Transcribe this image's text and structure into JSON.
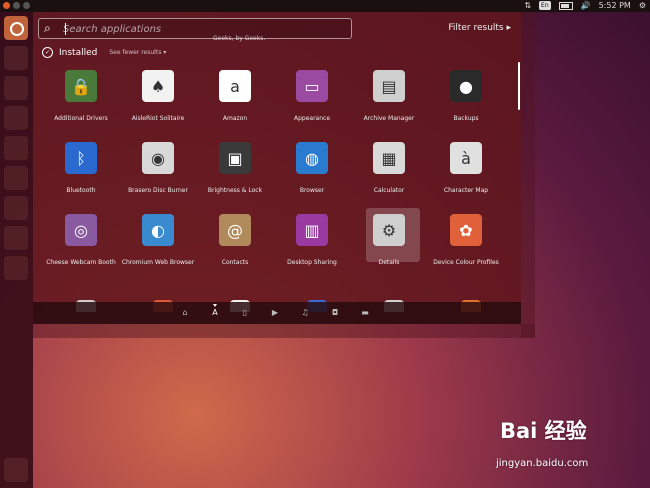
{
  "topbar": {
    "keyboard_layout": "En",
    "time": "5:52 PM"
  },
  "launcher": {
    "items": [
      "dash-home",
      "item-1",
      "item-2",
      "item-3",
      "item-4",
      "item-5",
      "item-6",
      "item-7",
      "item-8",
      "item-9",
      "trash"
    ]
  },
  "dash": {
    "search_placeholder": "Search applications",
    "filter_label": "Filter results ▸",
    "overlay_text": "Geeks, by Geeks.",
    "category_title": "Installed",
    "category_more": "See fewer results ▾",
    "apps": [
      {
        "label": "Additional Drivers",
        "icon": "chip-lock-icon",
        "color": "#4a7a3a"
      },
      {
        "label": "AisleRiot Solitaire",
        "icon": "cards-icon",
        "color": "#f2f2f2"
      },
      {
        "label": "Amazon",
        "icon": "amazon-icon",
        "color": "#ffffff"
      },
      {
        "label": "Appearance",
        "icon": "monitor-icon",
        "color": "#9a4aa0"
      },
      {
        "label": "Archive Manager",
        "icon": "archive-icon",
        "color": "#cfcfcf"
      },
      {
        "label": "Backups",
        "icon": "safe-icon",
        "color": "#2a2a2a"
      },
      {
        "label": "Bluetooth",
        "icon": "bluetooth-icon",
        "color": "#2a6ad0"
      },
      {
        "label": "Brasero Disc Burner",
        "icon": "disc-icon",
        "color": "#d8d8d8"
      },
      {
        "label": "Brightness & Lock",
        "icon": "monitor-lock-icon",
        "color": "#3a3a3a"
      },
      {
        "label": "Browser",
        "icon": "globe-icon",
        "color": "#2a7ad0"
      },
      {
        "label": "Calculator",
        "icon": "calculator-icon",
        "color": "#d9d9d9"
      },
      {
        "label": "Character Map",
        "icon": "charmap-icon",
        "color": "#e0e0e0"
      },
      {
        "label": "Cheese Webcam Booth",
        "icon": "webcam-icon",
        "color": "#8a5aa0"
      },
      {
        "label": "Chromium Web Browser",
        "icon": "chromium-icon",
        "color": "#3a8ad0"
      },
      {
        "label": "Contacts",
        "icon": "contacts-icon",
        "color": "#b08a5a"
      },
      {
        "label": "Desktop Sharing",
        "icon": "desktop-share-icon",
        "color": "#9a3aa0"
      },
      {
        "label": "Details",
        "icon": "gear-icon",
        "color": "#cfcfcf"
      },
      {
        "label": "Device Colour Profiles",
        "icon": "color-flower-icon",
        "color": "#e0603a"
      }
    ],
    "partial_icons": [
      "#cfcfcf",
      "#e05a3a",
      "#f0f0f0",
      "#3a6ad0",
      "#cfcfcf",
      "#e07030"
    ],
    "lenses": [
      "home-lens-icon",
      "applications-lens-icon",
      "files-lens-icon",
      "video-lens-icon",
      "music-lens-icon",
      "photos-lens-icon",
      "social-lens-icon"
    ],
    "active_lens": 1
  },
  "watermark": {
    "brand": "Bai 经验",
    "url": "jingyan.baidu.com"
  }
}
